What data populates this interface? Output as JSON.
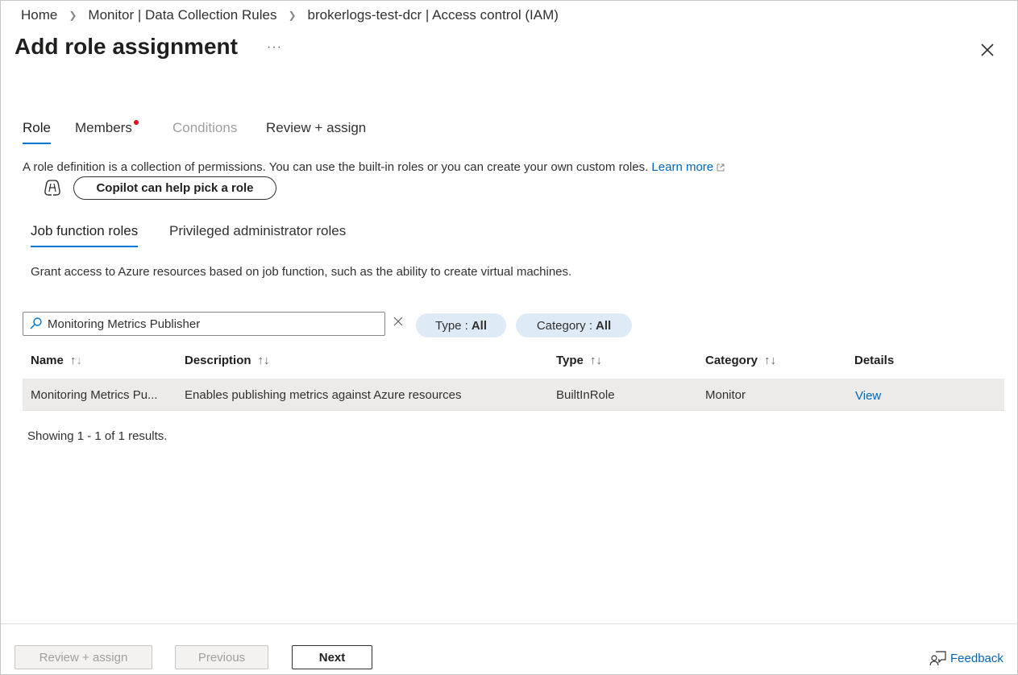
{
  "breadcrumb": {
    "items": [
      "Home",
      "Monitor | Data Collection Rules",
      "brokerlogs-test-dcr | Access control (IAM)"
    ]
  },
  "header": {
    "title": "Add role assignment",
    "more": "···"
  },
  "tabs": {
    "role": "Role",
    "members": "Members",
    "conditions": "Conditions",
    "review": "Review + assign"
  },
  "description": {
    "text": "A role definition is a collection of permissions. You can use the built-in roles or you can create your own custom roles.",
    "learn_more": "Learn more"
  },
  "copilot": {
    "label": "Copilot can help pick a role"
  },
  "subtabs": {
    "job": "Job function roles",
    "privileged": "Privileged administrator roles"
  },
  "subdescription": "Grant access to Azure resources based on job function, such as the ability to create virtual machines.",
  "search": {
    "value": "Monitoring Metrics Publisher"
  },
  "filters": {
    "type_label": "Type :",
    "type_value": "All",
    "category_label": "Category :",
    "category_value": "All"
  },
  "table": {
    "columns": {
      "name": "Name",
      "description": "Description",
      "type": "Type",
      "category": "Category",
      "details": "Details"
    },
    "rows": [
      {
        "name": "Monitoring Metrics Pu...",
        "description": "Enables publishing metrics against Azure resources",
        "type": "BuiltInRole",
        "category": "Monitor",
        "details": "View"
      }
    ]
  },
  "results": "Showing 1 - 1 of 1 results.",
  "footer": {
    "review": "Review + assign",
    "previous": "Previous",
    "next": "Next",
    "feedback": "Feedback"
  },
  "colors": {
    "accent": "#0078d4",
    "link": "#0067b8",
    "required": "#e00b1c",
    "pill_bg": "#dfeaf7",
    "selected_row": "#edebe9"
  }
}
